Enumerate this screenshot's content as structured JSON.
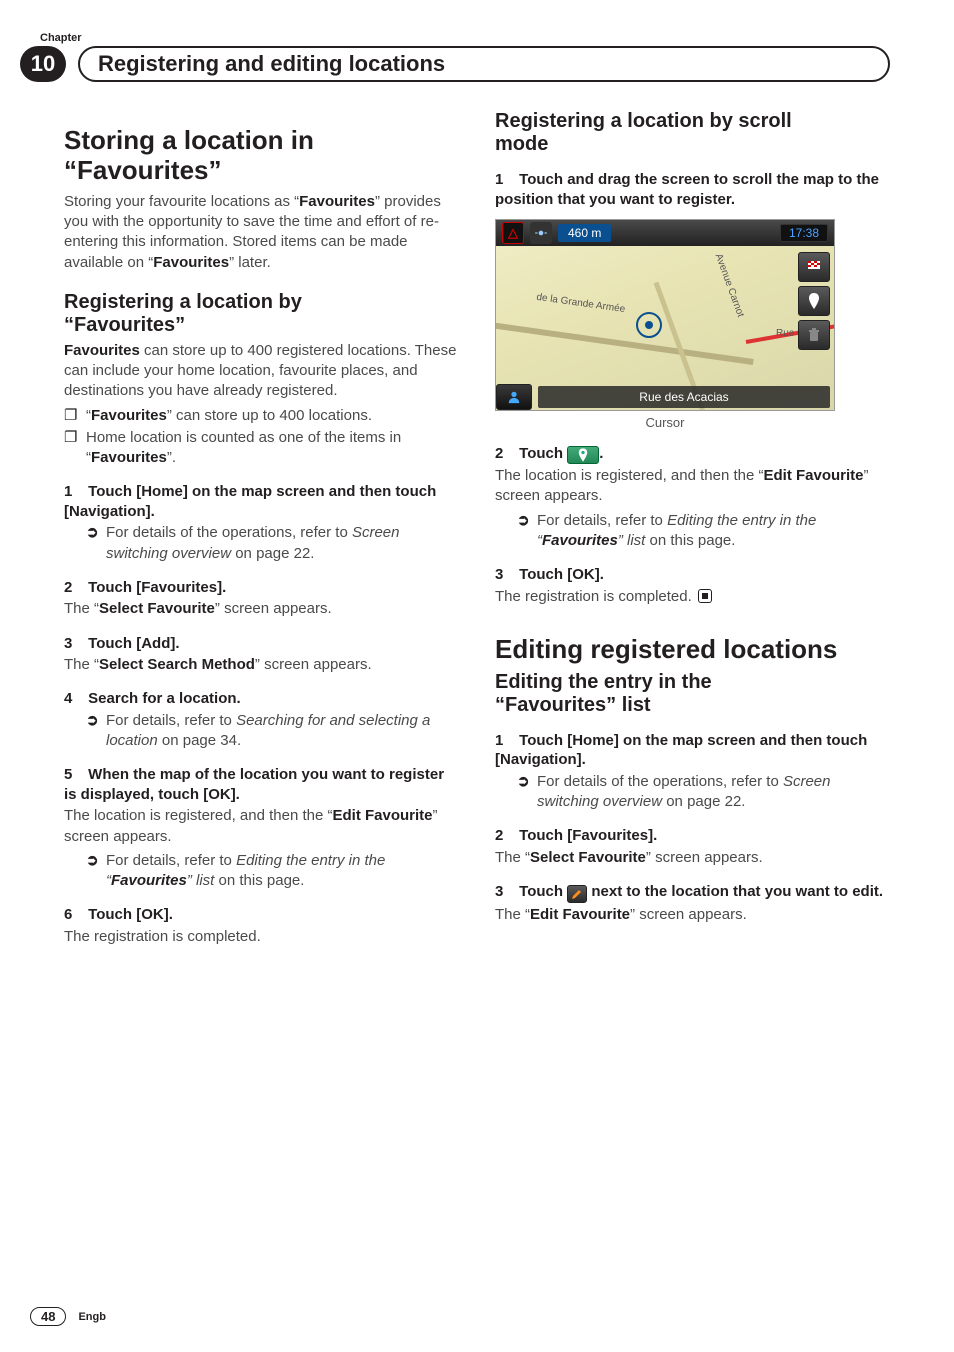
{
  "header": {
    "chapter_label": "Chapter",
    "chapter_number": "10",
    "chapter_title": "Registering and editing locations"
  },
  "left": {
    "h1_line1": "Storing a location in",
    "h1_line2": "“Favourites”",
    "intro_1": "Storing your favourite locations as “",
    "intro_2": "Favourites",
    "intro_3": "” provides you with the opportunity to save the time and effort of re-entering this information. Stored items can be made available on “",
    "intro_4": "Favourites",
    "intro_5": "” later.",
    "h2a_line1": "Registering a location by",
    "h2a_line2": "“Favourites”",
    "p2_1": "Favourites",
    "p2_2": " can store up to 400 registered locations. These can include your home location, favourite places, and destinations you have already registered.",
    "b1_pre": "“",
    "b1_bold": "Favourites",
    "b1_post": "” can store up to 400 locations.",
    "b2_pre": "Home location is counted as one of the items in “",
    "b2_bold": "Favourites",
    "b2_post": "”.",
    "s1_num": "1",
    "s1_txt": "Touch [Home] on the map screen and then touch [Navigation].",
    "s1_sub_pre": "For details of the operations, refer to ",
    "s1_sub_em": "Screen switching overview",
    "s1_sub_post": " on page 22.",
    "s2_num": "2",
    "s2_txt": "Touch [Favourites].",
    "s2_follow_pre": "The “",
    "s2_follow_bold": "Select Favourite",
    "s2_follow_post": "” screen appears.",
    "s3_num": "3",
    "s3_txt": "Touch [Add].",
    "s3_follow_pre": "The “",
    "s3_follow_bold": "Select Search Method",
    "s3_follow_post": "” screen appears.",
    "s4_num": "4",
    "s4_txt": "Search for a location.",
    "s4_sub_pre": "For details, refer to ",
    "s4_sub_em": "Searching for and selecting a location",
    "s4_sub_post": " on page 34.",
    "s5_num": "5",
    "s5_txt": "When the map of the location you want to register is displayed, touch [OK].",
    "s5_follow_pre": "The location is registered, and then the “",
    "s5_follow_bold": "Edit Favourite",
    "s5_follow_post": "” screen appears.",
    "s5_sub_pre": "For details, refer to ",
    "s5_sub_em1": "Editing the entry in the “",
    "s5_sub_bold": "Favourites",
    "s5_sub_em2": "” list",
    "s5_sub_post": " on this page.",
    "s6_num": "6",
    "s6_txt": "Touch [OK].",
    "s6_follow": "The registration is completed."
  },
  "right": {
    "h2b_line1": "Registering a location by scroll",
    "h2b_line2": "mode",
    "r1_num": "1",
    "r1_txt": "Touch and drag the screen to scroll the map to the position that you want to register.",
    "map": {
      "distance": "460 m",
      "time": "17:38",
      "street_lbl_1": "de la Grande Armée",
      "street_lbl_2": "Avenue Carnot",
      "street_lbl_3": "Rue Be",
      "bottom_street": "Rue des Acacias"
    },
    "cursor_caption": "Cursor",
    "r2_num": "2",
    "r2_pre": "Touch ",
    "r2_post": ".",
    "r2_follow_pre": "The location is registered, and then the “",
    "r2_follow_bold": "Edit Favourite",
    "r2_follow_post": "” screen appears.",
    "r2_sub_pre": "For details, refer to ",
    "r2_sub_em1": "Editing the entry in the “",
    "r2_sub_bold": "Favourites",
    "r2_sub_em2": "” list",
    "r2_sub_post": " on this page.",
    "r3_num": "3",
    "r3_txt": "Touch [OK].",
    "r3_follow": "The registration is completed.",
    "h1b": "Editing registered locations",
    "h2c_line1": "Editing the entry in the",
    "h2c_line2": "“Favourites” list",
    "e1_num": "1",
    "e1_txt": "Touch [Home] on the map screen and then touch [Navigation].",
    "e1_sub_pre": "For details of the operations, refer to ",
    "e1_sub_em": "Screen switching overview",
    "e1_sub_post": " on page 22.",
    "e2_num": "2",
    "e2_txt": "Touch [Favourites].",
    "e2_follow_pre": "The “",
    "e2_follow_bold": "Select Favourite",
    "e2_follow_post": "” screen appears.",
    "e3_num": "3",
    "e3_pre": "Touch ",
    "e3_post": " next to the location that you want to edit.",
    "e3_follow_pre": "The “",
    "e3_follow_bold": "Edit Favourite",
    "e3_follow_post": "” screen appears."
  },
  "footer": {
    "page": "48",
    "lang": "Engb"
  }
}
